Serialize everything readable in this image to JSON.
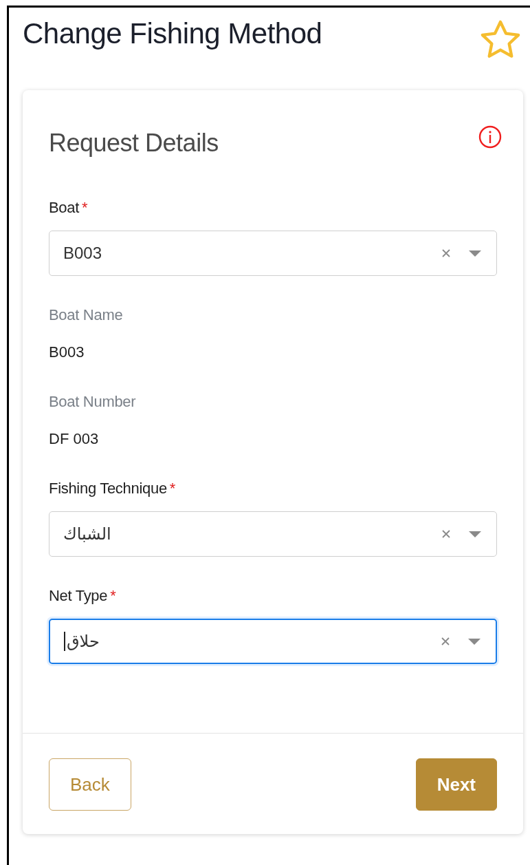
{
  "page": {
    "title": "Change Fishing Method",
    "favorite": false
  },
  "card": {
    "title": "Request Details",
    "required_mark": "*",
    "fields": [
      {
        "kind": "select",
        "label": "Boat",
        "required": true,
        "value": "B003",
        "focused": false
      },
      {
        "kind": "readonly",
        "label": "Boat Name",
        "value": "B003"
      },
      {
        "kind": "readonly",
        "label": "Boat Number",
        "value": "DF 003"
      },
      {
        "kind": "select",
        "label": "Fishing Technique",
        "required": true,
        "value": "الشباك",
        "focused": false
      },
      {
        "kind": "select",
        "label": "Net Type",
        "required": true,
        "value": "حلاق",
        "focused": true
      }
    ],
    "buttons": [
      {
        "kind": "outline",
        "label": "Back"
      },
      {
        "kind": "filled",
        "label": "Next"
      }
    ]
  }
}
